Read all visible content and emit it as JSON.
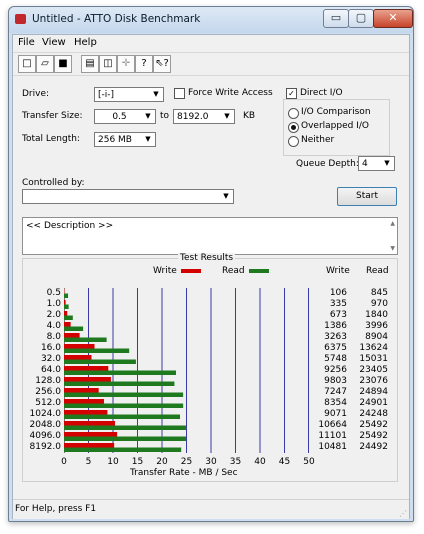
{
  "window": {
    "title": "Untitled - ATTO Disk Benchmark",
    "caption_min": "▭",
    "caption_max": "▢",
    "caption_close": "✕"
  },
  "menu": {
    "file": "File",
    "view": "View",
    "help": "Help"
  },
  "toolbar": {
    "icons": [
      "new-icon",
      "open-icon",
      "save-icon",
      "print-icon",
      "print-preview-icon",
      "move-icon",
      "help-icon",
      "context-help-icon"
    ]
  },
  "drive": {
    "label": "Drive:",
    "value": "[-i-]"
  },
  "transfer_size": {
    "label": "Transfer Size:",
    "from": "0.5",
    "to_label": "to",
    "to": "8192.0",
    "unit": "KB"
  },
  "total_length": {
    "label": "Total Length:",
    "value": "256 MB"
  },
  "force_write": {
    "label": "Force Write Access",
    "checked": false
  },
  "direct_io": {
    "label": "Direct I/O",
    "checked": true
  },
  "io_mode": {
    "options": [
      "I/O Comparison",
      "Overlapped I/O",
      "Neither"
    ],
    "selected": "Overlapped I/O"
  },
  "queue_depth": {
    "label": "Queue Depth:",
    "value": "4"
  },
  "controlled_by": {
    "label": "Controlled by:",
    "value": ""
  },
  "start_button": "Start",
  "description": {
    "text": "<< Description >>"
  },
  "results": {
    "title": "Test Results",
    "legend_write": "Write",
    "legend_read": "Read",
    "col_write": "Write",
    "col_read": "Read",
    "xlabel": "Transfer Rate - MB / Sec"
  },
  "colors": {
    "write": "#d40000",
    "read": "#1f7a1f",
    "grid": "#3a3aa8"
  },
  "chart_data": {
    "type": "bar",
    "orientation": "horizontal",
    "title": "Test Results",
    "xlabel": "Transfer Rate - MB / Sec",
    "categories": [
      "0.5",
      "1.0",
      "2.0",
      "4.0",
      "8.0",
      "16.0",
      "32.0",
      "64.0",
      "128.0",
      "256.0",
      "512.0",
      "1024.0",
      "2048.0",
      "4096.0",
      "8192.0"
    ],
    "xlim": [
      0,
      50
    ],
    "xticks": [
      "0",
      "5",
      "10",
      "15",
      "20",
      "25",
      "30",
      "35",
      "40",
      "45",
      "50"
    ],
    "grid": true,
    "legend": "top",
    "series": [
      {
        "name": "Write",
        "values_kb": [
          106,
          335,
          673,
          1386,
          3263,
          6375,
          5748,
          9256,
          9803,
          7247,
          8354,
          9071,
          10664,
          11101,
          10481
        ]
      },
      {
        "name": "Read",
        "values_kb": [
          845,
          970,
          1840,
          3996,
          8904,
          13624,
          15031,
          23405,
          23076,
          24894,
          24901,
          24248,
          25492,
          25492,
          24492
        ]
      }
    ]
  },
  "status": {
    "text": "For Help, press F1"
  }
}
